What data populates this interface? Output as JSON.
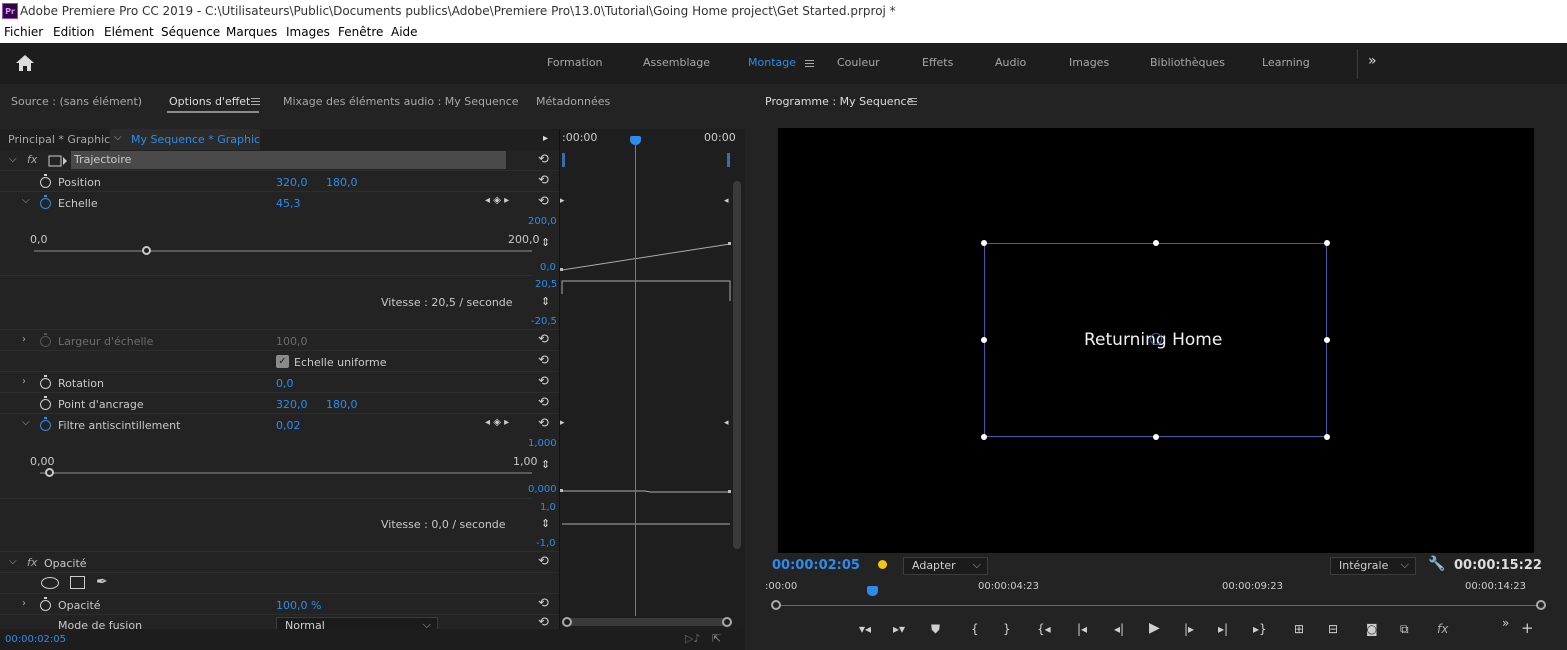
{
  "window": {
    "title": "Adobe Premiere Pro CC 2019 - C:\\Utilisateurs\\Public\\Documents publics\\Adobe\\Premiere Pro\\13.0\\Tutorial\\Going Home project\\Get Started.prproj *",
    "logo": "Pr"
  },
  "menu": [
    "Fichier",
    "Edition",
    "Elément",
    "Séquence",
    "Marques",
    "Images",
    "Fenêtre",
    "Aide"
  ],
  "workspaces": [
    "Formation",
    "Assemblage",
    "Montage",
    "Couleur",
    "Effets",
    "Audio",
    "Images",
    "Bibliothèques",
    "Learning"
  ],
  "workspace_more": "»",
  "left_tabs": {
    "source": "Source : (sans élément)",
    "effect_options": "Options d'effet",
    "audio_mixer": "Mixage des éléments audio : My Sequence",
    "metadata": "Métadonnées"
  },
  "clip_header": {
    "master": "Principal * Graphic",
    "sequence": "My Sequence * Graphic"
  },
  "effects": {
    "trajectory": "Trajectoire",
    "position": {
      "label": "Position",
      "x": "320,0",
      "y": "180,0"
    },
    "scale": {
      "label": "Echelle",
      "value": "45,3",
      "min": "0,0",
      "max": "200,0",
      "graph_top": "200,0",
      "graph_bottom": "0,0",
      "vel_top": "20,5",
      "vel_bottom": "-20,5",
      "speed": "Vitesse : 20,5 / seconde",
      "fraction": 0.226
    },
    "scale_width": {
      "label": "Largeur d'échelle",
      "value": "100,0"
    },
    "uniform": {
      "label": "Echelle uniforme",
      "checked": true
    },
    "rotation": {
      "label": "Rotation",
      "value": "0,0"
    },
    "anchor": {
      "label": "Point d'ancrage",
      "x": "320,0",
      "y": "180,0"
    },
    "flicker": {
      "label": "Filtre antiscintillement",
      "value": "0,02",
      "min": "0,00",
      "max": "1,00",
      "graph_top": "1,000",
      "graph_bottom": "0,000",
      "vel_top": "1,0",
      "vel_bottom": "-1,0",
      "speed": "Vitesse : 0,0 / seconde",
      "fraction": 0.02
    },
    "opacity_group": "Opacité",
    "opacity": {
      "label": "Opacité",
      "value": "100,0 %"
    },
    "blend": {
      "label": "Mode de fusion",
      "value": "Normal"
    }
  },
  "mini_timeline": {
    "start": ":00:00",
    "end": "00:00"
  },
  "left_timecode": "00:00:02:05",
  "program": {
    "title": "Programme : My Sequence",
    "text": "Returning Home",
    "timecode": "00:00:02:05",
    "fit": "Adapter",
    "quality": "Intégrale",
    "duration": "00:00:15:22",
    "ruler": [
      ":00:00",
      "00:00:04:23",
      "00:00:09:23",
      "00:00:14:23"
    ],
    "playhead_fraction": 0.13
  },
  "colors": {
    "accent": "#2d8ceb",
    "marker": "#f2c511"
  }
}
